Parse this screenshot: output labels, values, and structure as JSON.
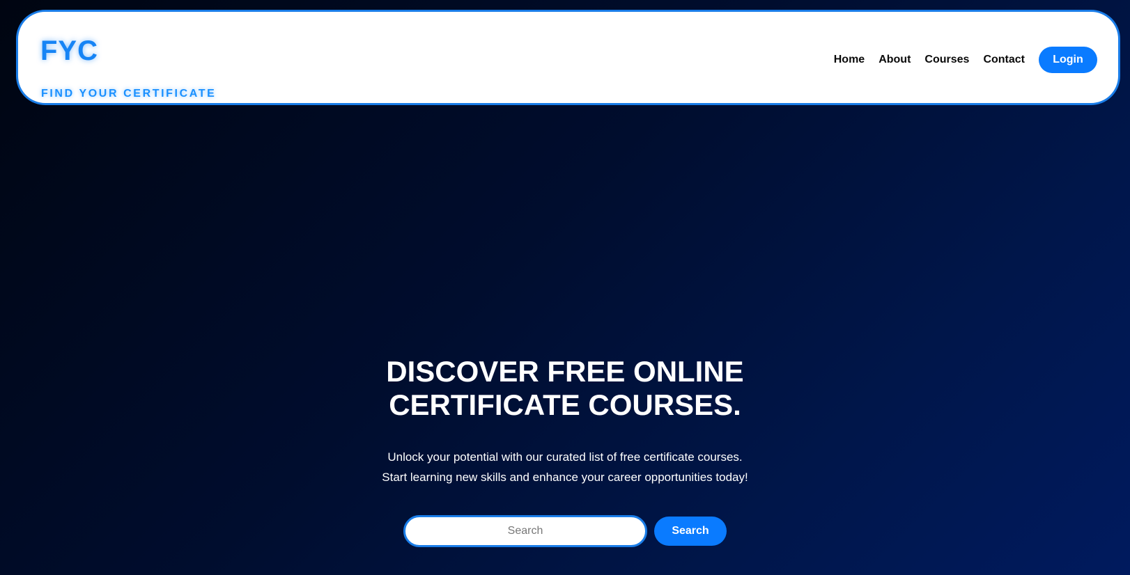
{
  "header": {
    "logo": "FYC",
    "tagline": "FIND YOUR CERTIFICATE",
    "nav": {
      "home": "Home",
      "about": "About",
      "courses": "Courses",
      "contact": "Contact"
    },
    "login_label": "Login"
  },
  "hero": {
    "title_line1": "DISCOVER FREE ONLINE",
    "title_line2": "CERTIFICATE COURSES.",
    "subtitle_line1": "Unlock your potential with our curated list of free certificate courses.",
    "subtitle_line2": "Start learning new skills and enhance your career opportunities today!",
    "search_placeholder": "Search",
    "search_button": "Search"
  },
  "colors": {
    "accent": "#0a7bff",
    "border": "#1a7de8",
    "background": "#000d2e"
  }
}
